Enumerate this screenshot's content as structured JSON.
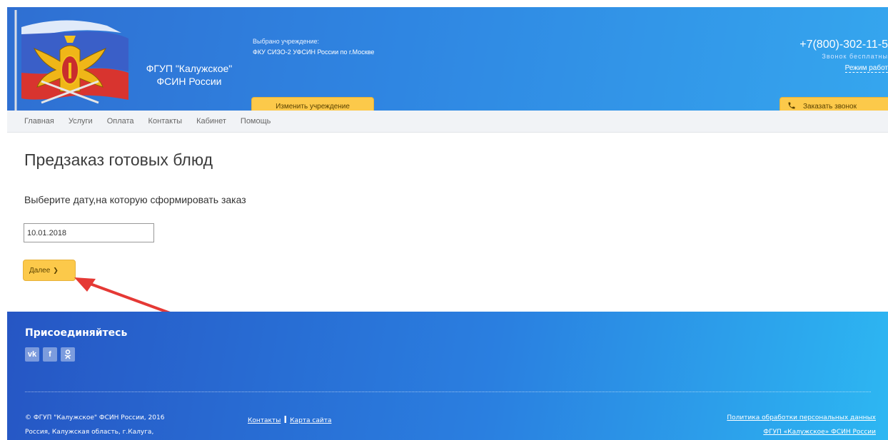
{
  "header": {
    "brand_line1": "ФГУП \"Калужское\"",
    "brand_line2": "ФСИН России",
    "selected_label": "Выбрано учреждение:",
    "selected_value": "ФКУ СИЗО-2 УФСИН России по г.Москве",
    "change_button": "Изменить учреждение",
    "phone": "+7(800)-302-11-5",
    "call_free": "Звонок бесплатны",
    "mode": "Режим работ",
    "order_call_button": "Заказать звонок"
  },
  "nav": {
    "items": [
      {
        "label": "Главная"
      },
      {
        "label": "Услуги"
      },
      {
        "label": "Оплата"
      },
      {
        "label": "Контакты"
      },
      {
        "label": "Кабинет"
      },
      {
        "label": "Помощь"
      }
    ]
  },
  "main": {
    "title": "Предзаказ готовых блюд",
    "prompt": "Выберите дату,на которую сформировать заказ",
    "date_value": "10.01.2018",
    "next_button": "Далее",
    "next_icon": "❯"
  },
  "footer": {
    "join": "Присоединяйтесь",
    "socials": [
      "vk-icon",
      "facebook-icon",
      "odnoklassniki-icon"
    ],
    "copyright_line1": "© ФГУП \"Калужское\" ФСИН России, 2016",
    "copyright_line2": "Россия, Калужская область, г.Калуга,",
    "link_contacts": "Контакты",
    "link_sitemap": "Карта сайта",
    "separator": "I",
    "privacy": "Политика обработки персональных данных",
    "org": "ФГУП «Калужское» ФСИН России"
  },
  "colors": {
    "accent_yellow": "#fcc94a",
    "header_blue": "#2f86e2",
    "arrow_red": "#e53935"
  }
}
